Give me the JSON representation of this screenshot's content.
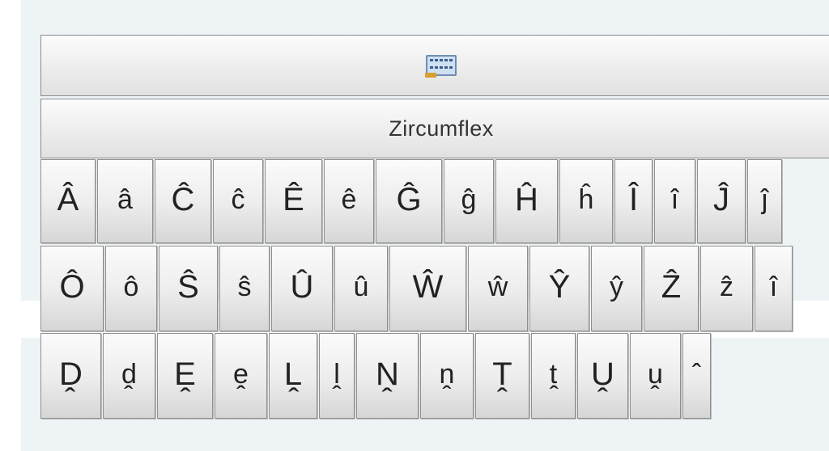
{
  "toolbar": {
    "icon": "keyboard-icon",
    "title": "Zircumflex"
  },
  "keys": {
    "row1": [
      "Â",
      "â",
      "Ĉ",
      "ĉ",
      "Ê",
      "ê",
      "Ĝ",
      "ĝ",
      "Ĥ",
      "ĥ",
      "Î",
      "î",
      "Ĵ",
      "ĵ"
    ],
    "row2": [
      "Ô",
      "ô",
      "Ŝ",
      "ŝ",
      "Û",
      "û",
      "Ŵ",
      "ŵ",
      "Ŷ",
      "ŷ",
      "Ẑ",
      "ẑ",
      "î"
    ],
    "row3": [
      "Ḓ",
      "ḓ",
      "Ḙ",
      "ḙ",
      "Ḽ",
      "ḽ",
      "Ṋ",
      "ṋ",
      "Ṱ",
      "ṱ",
      "Ṷ",
      "ṷ",
      "ˆ"
    ]
  },
  "colors": {
    "panel_background": "#eef3f6",
    "key_border": "#8f8f8f",
    "key_text": "#222222"
  }
}
